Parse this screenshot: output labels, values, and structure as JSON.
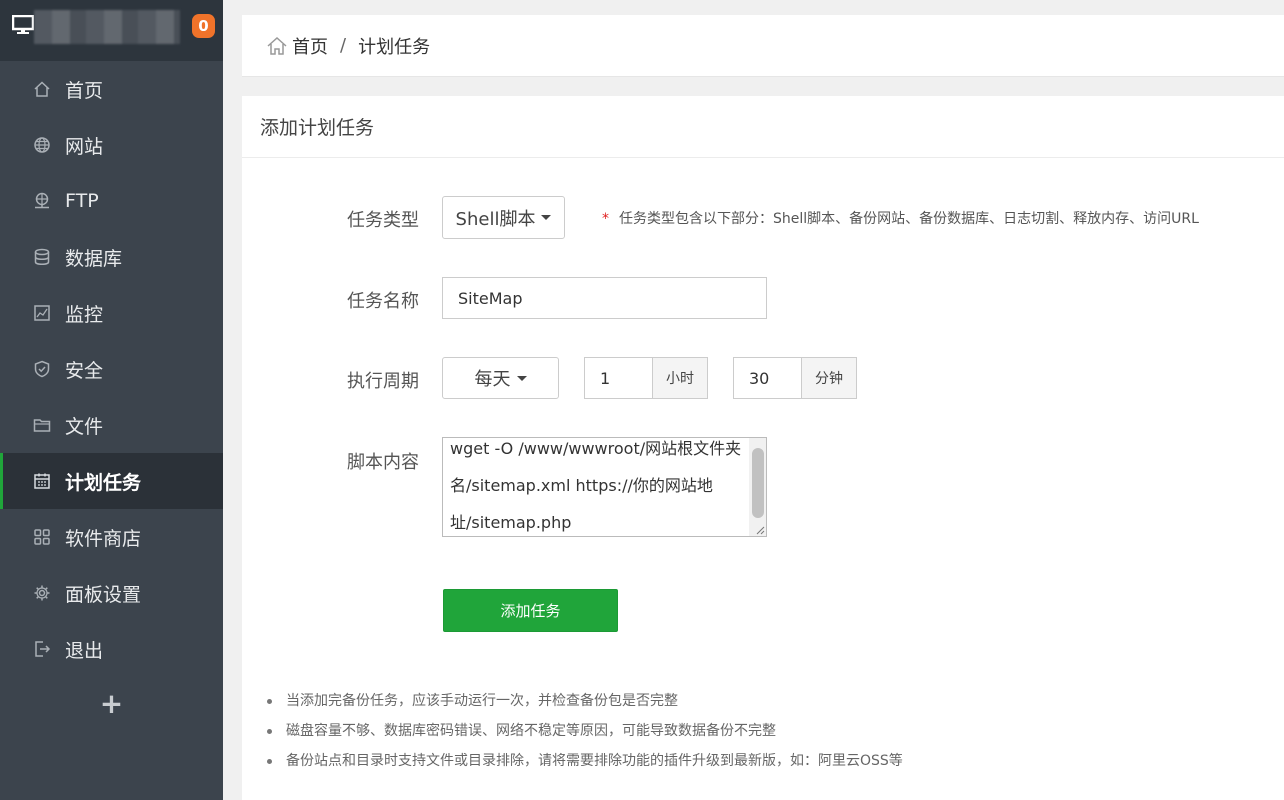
{
  "sidebar": {
    "badge": "0",
    "items": [
      {
        "label": "首页",
        "icon": "home-icon"
      },
      {
        "label": "网站",
        "icon": "globe-icon"
      },
      {
        "label": "FTP",
        "icon": "ftp-icon"
      },
      {
        "label": "数据库",
        "icon": "database-icon"
      },
      {
        "label": "监控",
        "icon": "monitor-chart-icon"
      },
      {
        "label": "安全",
        "icon": "shield-icon"
      },
      {
        "label": "文件",
        "icon": "folder-icon"
      },
      {
        "label": "计划任务",
        "icon": "calendar-icon",
        "active": true
      },
      {
        "label": "软件商店",
        "icon": "apps-grid-icon"
      },
      {
        "label": "面板设置",
        "icon": "gear-icon"
      },
      {
        "label": "退出",
        "icon": "logout-icon"
      }
    ],
    "add_label": "+"
  },
  "breadcrumb": {
    "home": "首页",
    "separator": "/",
    "current": "计划任务"
  },
  "panel": {
    "title": "添加计划任务"
  },
  "form": {
    "task_type_label": "任务类型",
    "task_type_value": "Shell脚本",
    "task_type_hint_star": "*",
    "task_type_hint": "任务类型包含以下部分：Shell脚本、备份网站、备份数据库、日志切割、释放内存、访问URL",
    "task_name_label": "任务名称",
    "task_name_value": "SiteMap",
    "period_label": "执行周期",
    "period_value": "每天",
    "hour_value": "1",
    "hour_unit": "小时",
    "minute_value": "30",
    "minute_unit": "分钟",
    "script_label": "脚本内容",
    "script_lines": [
      "wget -O /www/wwwroot/网站根文件夹",
      "名/sitemap.xml https://你的网站地",
      "址/sitemap.php"
    ],
    "submit_label": "添加任务"
  },
  "notes": [
    "当添加完备份任务，应该手动运行一次，并检查备份包是否完整",
    "磁盘容量不够、数据库密码错误、网络不稳定等原因，可能导致数据备份不完整",
    "备份站点和目录时支持文件或目录排除，请将需要排除功能的插件升级到最新版，如：阿里云OSS等"
  ],
  "colors": {
    "sidebar_bg": "#3c444d",
    "sidebar_header_bg": "#2d353d",
    "accent_green": "#20a53a",
    "badge_orange": "#f0732a"
  }
}
